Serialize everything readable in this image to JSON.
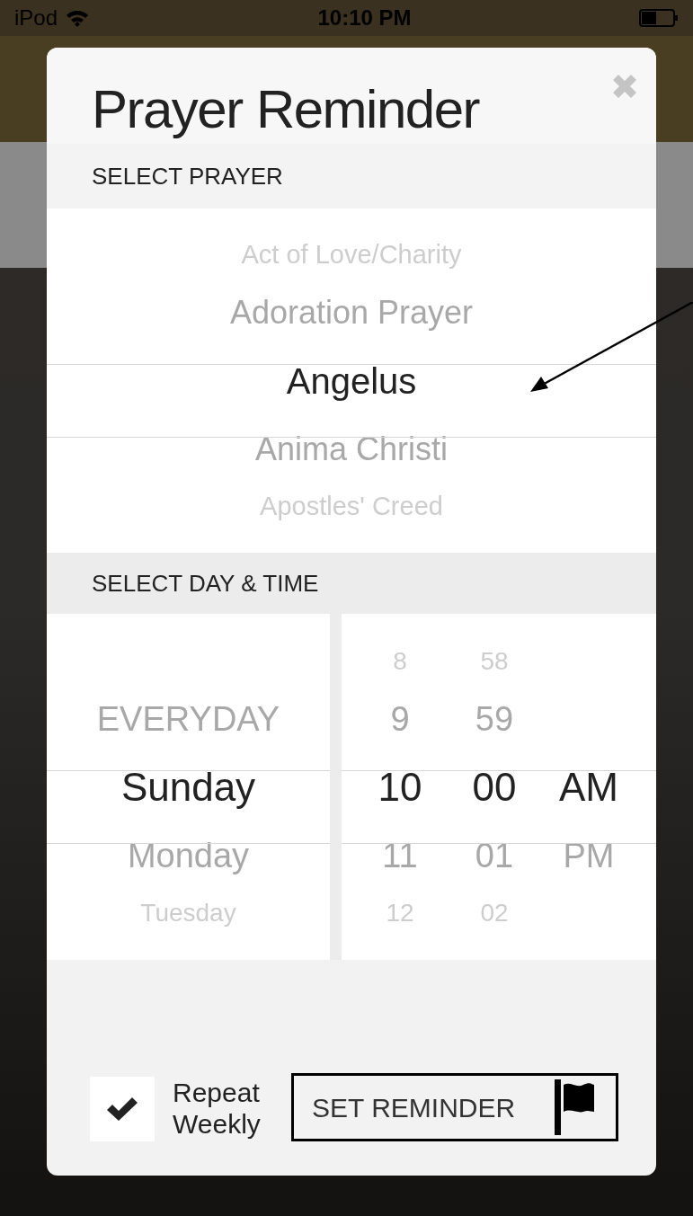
{
  "status_bar": {
    "carrier": "iPod",
    "time": "10:10 PM"
  },
  "dialog": {
    "title": "Prayer Reminder",
    "prayer_section": {
      "heading": "SELECT PRAYER",
      "options": [
        {
          "label": "Act of Love/Charity",
          "selected": false
        },
        {
          "label": "Adoration Prayer",
          "selected": false
        },
        {
          "label": "Angelus",
          "selected": true
        },
        {
          "label": "Anima Christi",
          "selected": false
        },
        {
          "label": "Apostles' Creed",
          "selected": false
        }
      ]
    },
    "time_section": {
      "heading": "SELECT DAY & TIME",
      "day_options": [
        {
          "label": "EVERYDAY",
          "selected": false
        },
        {
          "label": "Sunday",
          "selected": true
        },
        {
          "label": "Monday",
          "selected": false
        },
        {
          "label": "Tuesday",
          "selected": false
        }
      ],
      "hour_options": [
        {
          "label": "8",
          "selected": false
        },
        {
          "label": "9",
          "selected": false
        },
        {
          "label": "10",
          "selected": true
        },
        {
          "label": "11",
          "selected": false
        },
        {
          "label": "12",
          "selected": false
        }
      ],
      "minute_options": [
        {
          "label": "58",
          "selected": false
        },
        {
          "label": "59",
          "selected": false
        },
        {
          "label": "00",
          "selected": true
        },
        {
          "label": "01",
          "selected": false
        },
        {
          "label": "02",
          "selected": false
        }
      ],
      "period_options": [
        {
          "label": "AM",
          "selected": true
        },
        {
          "label": "PM",
          "selected": false
        }
      ]
    },
    "repeat": {
      "label": "Repeat Weekly",
      "checked": true
    },
    "set_button": {
      "label": "SET REMINDER"
    }
  }
}
